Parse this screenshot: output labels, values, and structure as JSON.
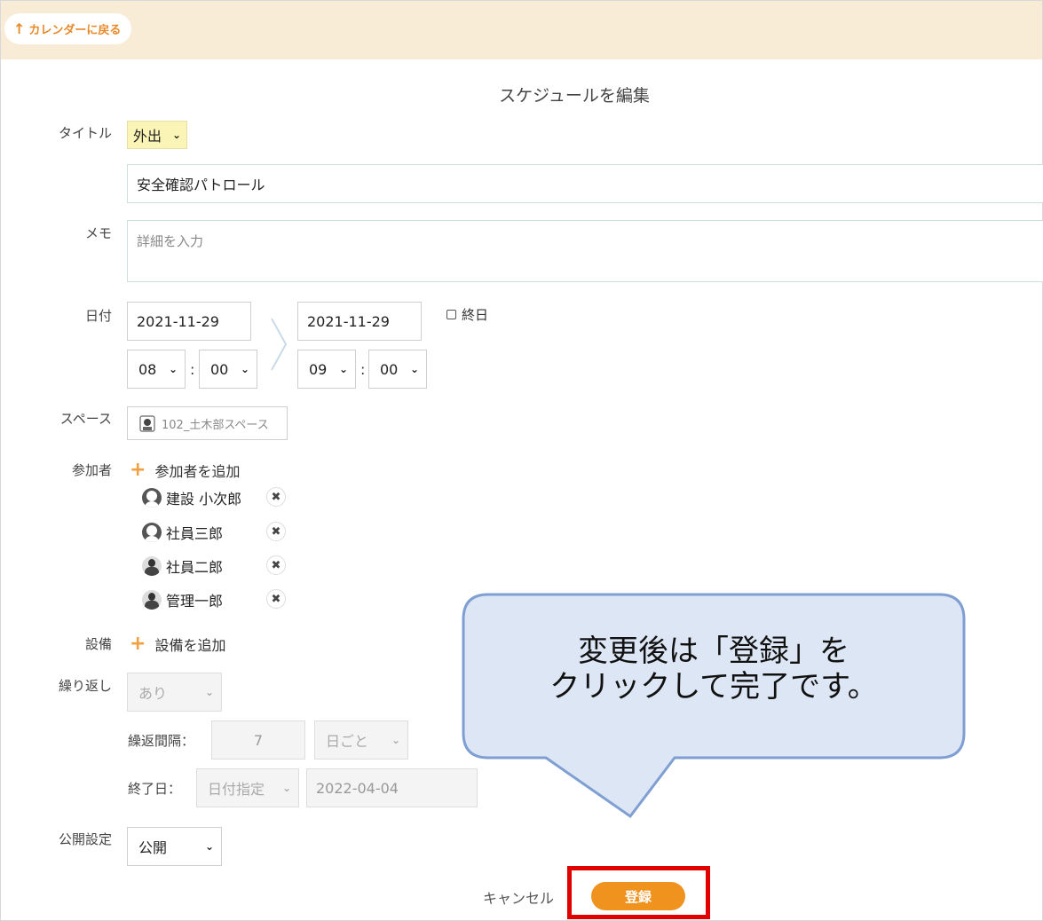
{
  "topbar": {
    "back_label": "カレンダーに戻る"
  },
  "page_title": "スケジュールを編集",
  "form": {
    "title_label": "タイトル",
    "category_value": "外出",
    "title_value": "安全確認パトロール",
    "memo_label": "メモ",
    "memo_placeholder": "詳細を入力",
    "date_label": "日付",
    "start_date": "2021-11-29",
    "end_date": "2021-11-29",
    "start_hour": "08",
    "start_minute": "00",
    "end_hour": "09",
    "end_minute": "00",
    "time_separator": ":",
    "all_day_label": "終日",
    "space_label": "スペース",
    "space_value": "102_土木部スペース",
    "participants_label": "参加者",
    "add_participant_label": "参加者を追加",
    "participants": [
      {
        "name": "建設 小次郎",
        "avatar": "default-avatar"
      },
      {
        "name": "社員三郎",
        "avatar": "default-avatar"
      },
      {
        "name": "社員二郎",
        "avatar": "photo-avatar"
      },
      {
        "name": "管理一郎",
        "avatar": "photo-avatar"
      }
    ],
    "remove_symbol": "✖",
    "equipment_label": "設備",
    "add_equipment_label": "設備を追加",
    "repeat_label": "繰り返し",
    "repeat_value": "あり",
    "interval_label": "繰返間隔：",
    "interval_value": "7",
    "interval_unit": "日ごと",
    "end_label": "終了日：",
    "end_type": "日付指定",
    "end_date_value": "2022-04-04",
    "visibility_label": "公開設定",
    "visibility_value": "公開"
  },
  "actions": {
    "cancel_label": "キャンセル",
    "register_label": "登録"
  },
  "callout": {
    "line1": "変更後は「登録」を",
    "line2": "クリックして完了です。"
  },
  "colors": {
    "accent": "#f0921e",
    "topbar": "#f9ecd6",
    "highlight": "#e00000",
    "callout_fill": "#dde6f4",
    "callout_stroke": "#7f9fd2"
  }
}
